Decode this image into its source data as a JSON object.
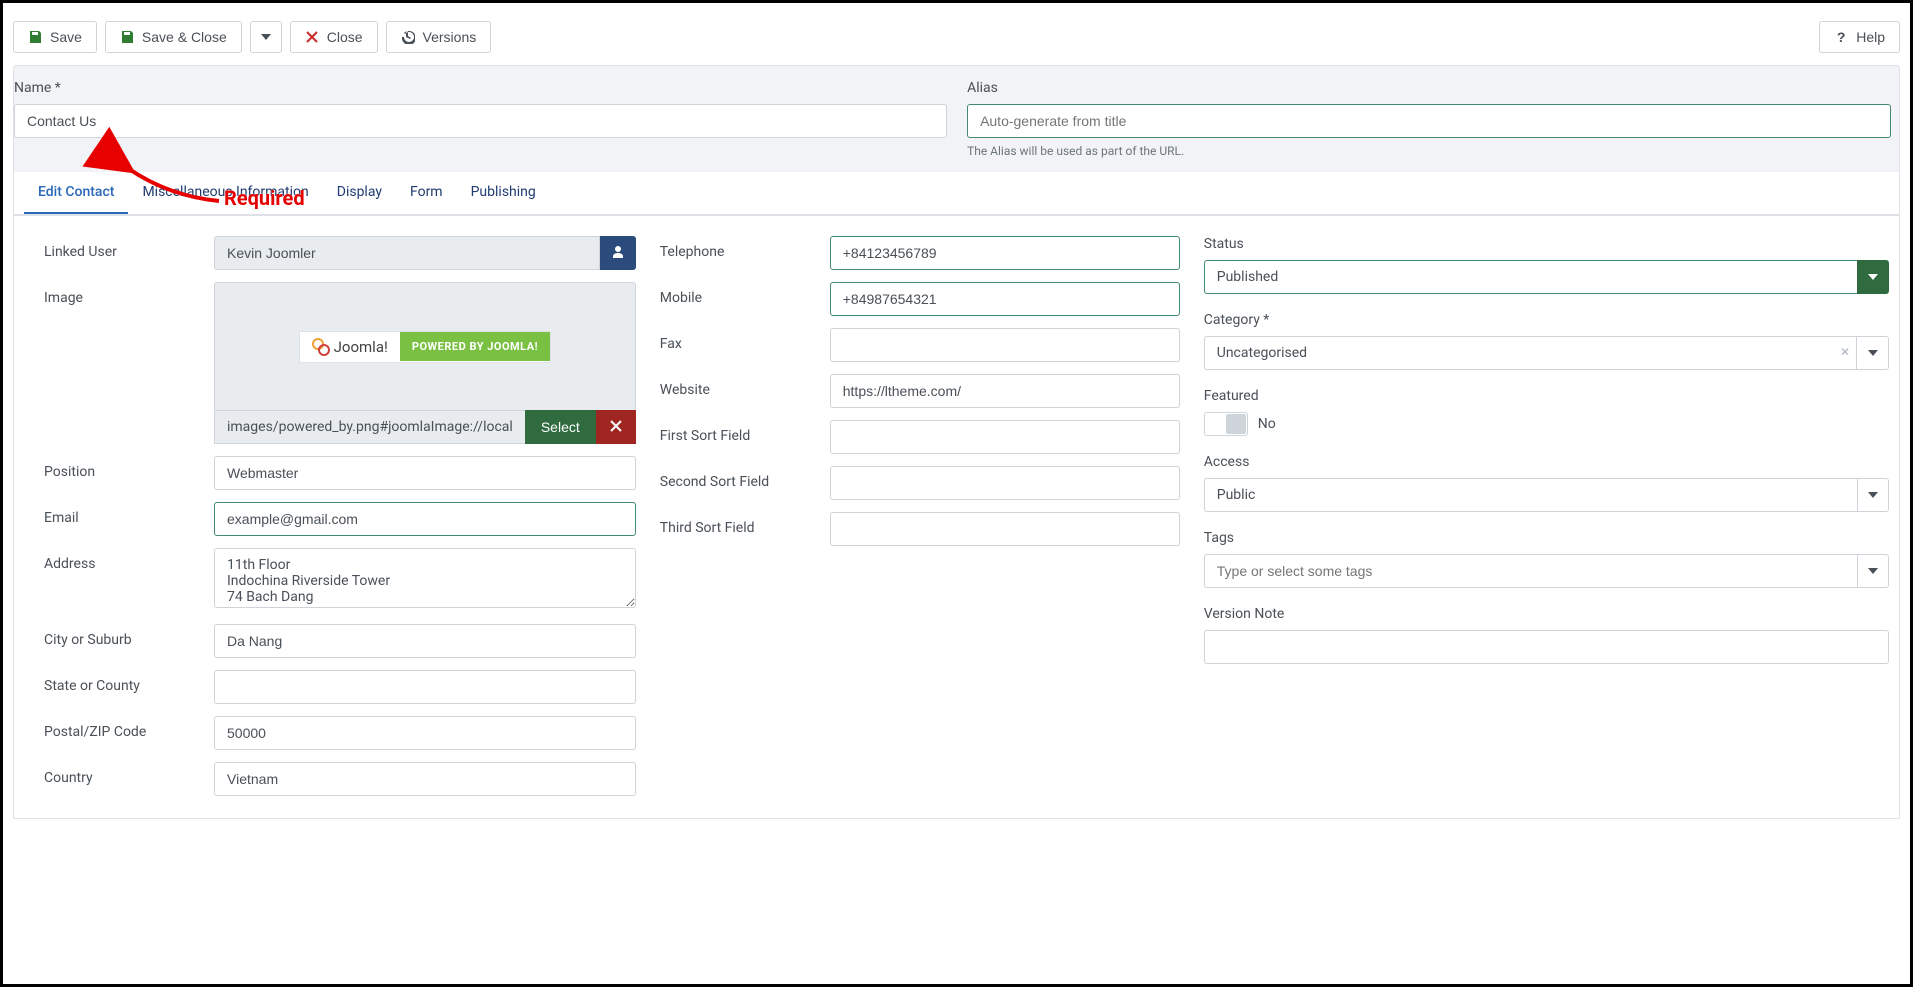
{
  "toolbar": {
    "save": "Save",
    "saveClose": "Save & Close",
    "close": "Close",
    "versions": "Versions",
    "help": "Help"
  },
  "header": {
    "nameLabel": "Name *",
    "nameValue": "Contact Us",
    "aliasLabel": "Alias",
    "aliasPlaceholder": "Auto-generate from title",
    "aliasHint": "The Alias will be used as part of the URL."
  },
  "annotation": {
    "text": "Required"
  },
  "tabs": [
    {
      "label": "Edit Contact",
      "active": true
    },
    {
      "label": "Miscellaneous Information",
      "active": false
    },
    {
      "label": "Display",
      "active": false
    },
    {
      "label": "Form",
      "active": false
    },
    {
      "label": "Publishing",
      "active": false
    }
  ],
  "col1": {
    "linkedUser": {
      "label": "Linked User",
      "value": "Kevin Joomler"
    },
    "image": {
      "label": "Image",
      "joomlaText": "Joomla!",
      "poweredText": "POWERED BY JOOMLA!",
      "path": "images/powered_by.png#joomlaImage://local",
      "selectBtn": "Select"
    },
    "position": {
      "label": "Position",
      "value": "Webmaster"
    },
    "email": {
      "label": "Email",
      "value": "example@gmail.com"
    },
    "address": {
      "label": "Address",
      "value": "11th Floor\nIndochina Riverside Tower\n74 Bach Dang"
    },
    "city": {
      "label": "City or Suburb",
      "value": "Da Nang"
    },
    "state": {
      "label": "State or County",
      "value": ""
    },
    "postal": {
      "label": "Postal/ZIP Code",
      "value": "50000"
    },
    "country": {
      "label": "Country",
      "value": "Vietnam"
    }
  },
  "col2": {
    "telephone": {
      "label": "Telephone",
      "value": "+84123456789"
    },
    "mobile": {
      "label": "Mobile",
      "value": "+84987654321"
    },
    "fax": {
      "label": "Fax",
      "value": ""
    },
    "website": {
      "label": "Website",
      "value": "https://ltheme.com/"
    },
    "sort1": {
      "label": "First Sort Field",
      "value": ""
    },
    "sort2": {
      "label": "Second Sort Field",
      "value": ""
    },
    "sort3": {
      "label": "Third Sort Field",
      "value": ""
    }
  },
  "sidebar": {
    "status": {
      "label": "Status",
      "value": "Published"
    },
    "category": {
      "label": "Category *",
      "value": "Uncategorised"
    },
    "featured": {
      "label": "Featured",
      "text": "No"
    },
    "access": {
      "label": "Access",
      "value": "Public"
    },
    "tags": {
      "label": "Tags",
      "placeholder": "Type or select some tags"
    },
    "versionNote": {
      "label": "Version Note",
      "value": ""
    }
  }
}
